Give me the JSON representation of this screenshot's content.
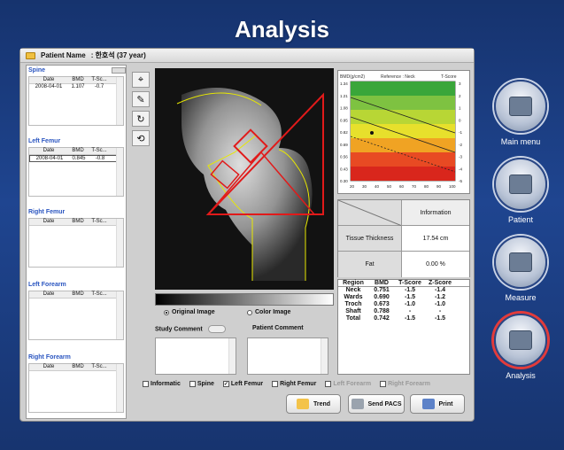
{
  "app_title": "Analysis",
  "patient": {
    "label": "Patient Name",
    "value": ": 한호석 (37 year)"
  },
  "sections": [
    {
      "title": "Spine",
      "columns": [
        "Date",
        "BMD",
        "T-Sc..."
      ],
      "rows": [
        [
          "2008-04-01",
          "1.107",
          "-0.7"
        ]
      ]
    },
    {
      "title": "Left Femur",
      "columns": [
        "Date",
        "BMD",
        "T-Sc..."
      ],
      "rows": [
        [
          "2008-04-01",
          "0.845",
          "-0.8"
        ]
      ]
    },
    {
      "title": "Right Femur",
      "columns": [
        "Date",
        "BMD",
        "T-Sc..."
      ],
      "rows": []
    },
    {
      "title": "Left Forearm",
      "columns": [
        "Date",
        "BMD",
        "T-Sc..."
      ],
      "rows": []
    },
    {
      "title": "Right Forearm",
      "columns": [
        "Date",
        "BMD",
        "T-Sc..."
      ],
      "rows": []
    }
  ],
  "image_modes": {
    "original": "Original Image",
    "color": "Color Image"
  },
  "comments": {
    "study": "Study Comment",
    "patient": "Patient Comment"
  },
  "checks": [
    {
      "label": "Informatic",
      "checked": false,
      "enabled": true
    },
    {
      "label": "Spine",
      "checked": false,
      "enabled": true
    },
    {
      "label": "Left Femur",
      "checked": true,
      "enabled": true
    },
    {
      "label": "Right Femur",
      "checked": false,
      "enabled": true
    },
    {
      "label": "Left Forearm",
      "checked": false,
      "enabled": false
    },
    {
      "label": "Right Forearm",
      "checked": false,
      "enabled": false
    }
  ],
  "reference_chart": {
    "ylabel": "BMD(g/cm2)",
    "title": "Reference : Neck",
    "tscore_label": "T-Score",
    "y_ticks": [
      "1.34",
      "1.21",
      "1.08",
      "0.95",
      "0.82",
      "0.69",
      "0.56",
      "0.43",
      "0.30"
    ],
    "t_ticks": [
      "3",
      "2",
      "1",
      "0",
      "-1",
      "-2",
      "-3",
      "-4",
      "-5"
    ],
    "x_ticks": [
      "20",
      "30",
      "40",
      "50",
      "60",
      "70",
      "80",
      "90",
      "100"
    ],
    "band_colors": [
      "#3aa63a",
      "#7ec241",
      "#b8d635",
      "#e7e02c",
      "#f0a323",
      "#e84a23",
      "#d9261c"
    ]
  },
  "info": {
    "header": "Information",
    "rows": [
      {
        "label": "Tissue Thickness",
        "value": "17.54 cm"
      },
      {
        "label": "Fat",
        "value": "0.00 %"
      }
    ]
  },
  "regions": {
    "columns": [
      "Region",
      "BMD",
      "T-Score",
      "Z-Score"
    ],
    "rows": [
      [
        "Neck",
        "0.751",
        "-1.5",
        "-1.4"
      ],
      [
        "Wards",
        "0.690",
        "-1.5",
        "-1.2"
      ],
      [
        "Troch",
        "0.673",
        "-1.0",
        "-1.0"
      ],
      [
        "Shaft",
        "0.788",
        "-",
        "-"
      ],
      [
        "Total",
        "0.742",
        "-1.5",
        "-1.5"
      ]
    ]
  },
  "buttons": {
    "trend": "Trend",
    "send_pacs": "Send PACS",
    "print": "Print"
  },
  "nav": [
    {
      "label": "Main menu",
      "icon": "computer-icon"
    },
    {
      "label": "Patient",
      "icon": "patient-icon"
    },
    {
      "label": "Measure",
      "icon": "scanner-icon"
    },
    {
      "label": "Analysis",
      "icon": "pen-icon",
      "active": true
    }
  ]
}
